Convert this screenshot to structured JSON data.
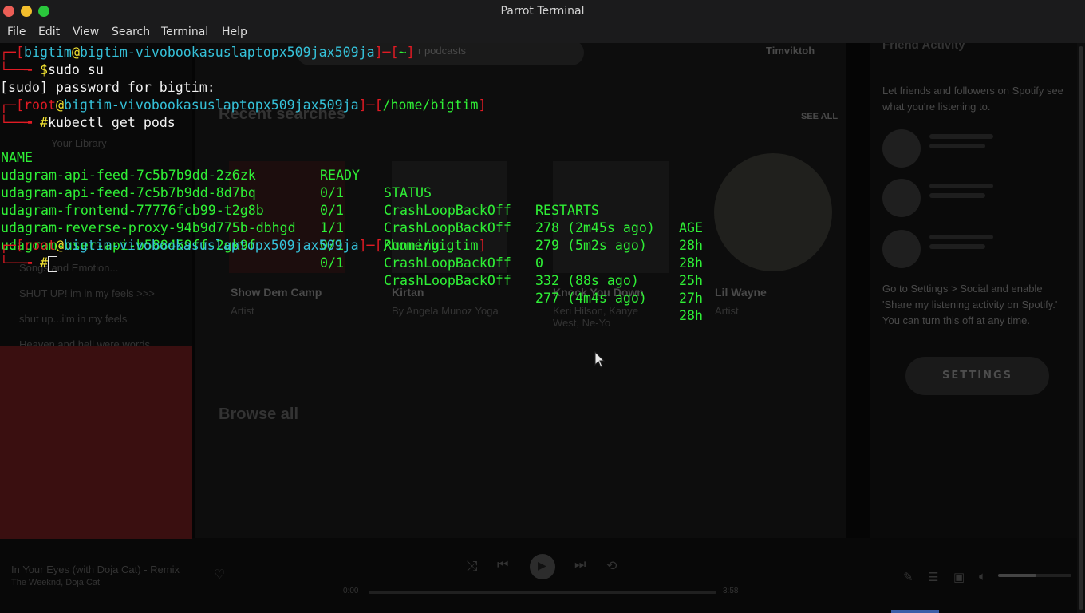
{
  "window": {
    "title": "Parrot Terminal"
  },
  "menu": [
    "File",
    "Edit",
    "View",
    "Search",
    "Terminal",
    "Help"
  ],
  "terminal": {
    "user1": "bigtim",
    "host": "bigtim-vivobookasuslaptopx509jax509ja",
    "cwd1": "~",
    "cmd1": "sudo su",
    "sudo_prompt": "[sudo] password for bigtim:",
    "user2": "root",
    "cwd2": "/home/bigtim",
    "cmd2": "kubectl get pods",
    "headers": [
      "NAME",
      "READY",
      "STATUS",
      "RESTARTS",
      "AGE"
    ],
    "rows": [
      [
        "udagram-api-feed-7c5b7b9dd-2z6zk",
        "0/1",
        "CrashLoopBackOff",
        "278 (2m45s ago)",
        "28h"
      ],
      [
        "udagram-api-feed-7c5b7b9dd-8d7bq",
        "0/1",
        "CrashLoopBackOff",
        "279 (5m2s ago)",
        "28h"
      ],
      [
        "udagram-frontend-77776fcb99-t2g8b",
        "1/1",
        "Running",
        "0",
        "25h"
      ],
      [
        "udagram-reverse-proxy-94b9d775b-dbhgd",
        "0/1",
        "CrashLoopBackOff",
        "332 (88s ago)",
        "27h"
      ],
      [
        "udagram-user-api-b588459ff-2gk9f",
        "0/1",
        "CrashLoopBackOff",
        "277 (4m4s ago)",
        "28h"
      ]
    ],
    "user3": "root",
    "cwd3": "/home/bigtim",
    "prompt_user": "$",
    "prompt_root": "#"
  },
  "background_app": {
    "search_placeholder": "r podcasts",
    "username": "Timviktoh",
    "recent_searches": "Recent searches",
    "see_all": "SEE ALL",
    "your_library": "Your Library",
    "cards": [
      {
        "title": "Show Dem Camp",
        "subtitle": "Artist"
      },
      {
        "title": "Kirtan",
        "subtitle": "By Angela Munoz Yoga"
      },
      {
        "title": "Knock You Down",
        "subtitle": "Keri Hilson, Kanye West, Ne-Yo"
      },
      {
        "title": "Lil Wayne",
        "subtitle": "Artist"
      }
    ],
    "browse_all": "Browse all",
    "playlists": [
      "Songs and Emotion...",
      "SHUT UP! im in my feels >>>",
      "shut up...i'm in my feels",
      "Heaven and hell were words"
    ],
    "friend_activity": "Friend Activity",
    "friend_text": "Let friends and followers on Spotify see what you're listening to.",
    "settings_text": "Go to Settings > Social and enable 'Share my listening activity on Spotify.' You can turn this off at any time.",
    "settings_button": "SETTINGS",
    "now_playing_title": "In Your Eyes (with Doja Cat) - Remix",
    "now_playing_artist": "The Weeknd, Doja Cat",
    "time_elapsed": "0:00",
    "time_total": "3:58",
    "volume_level": 0.52
  }
}
